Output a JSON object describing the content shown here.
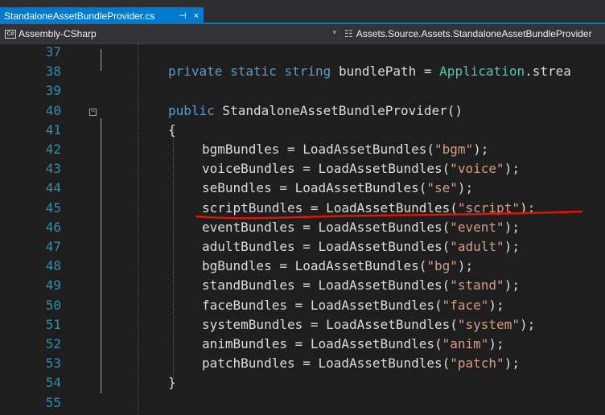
{
  "tab": {
    "filename": "StandaloneAssetBundleProvider.cs",
    "pin_glyph": "⊣",
    "close_glyph": "×"
  },
  "nav": {
    "project": "Assembly-CSharp",
    "project_badge": "C#",
    "scope": "Assets.Source.Assets.StandaloneAssetBundleProvider",
    "dropdown_glyph": "▾"
  },
  "editor": {
    "line_numbers": [
      "37",
      "38",
      "39",
      "40",
      "41",
      "42",
      "43",
      "44",
      "45",
      "46",
      "47",
      "48",
      "49",
      "50",
      "51",
      "52",
      "53",
      "54",
      "55"
    ],
    "lines": [
      {
        "line": "37",
        "indent": 0,
        "tokens": []
      },
      {
        "line": "38",
        "indent": 0,
        "tokens": [
          {
            "t": "kw",
            "v": "private"
          },
          {
            "t": "pl",
            "v": " "
          },
          {
            "t": "kw",
            "v": "static"
          },
          {
            "t": "pl",
            "v": " "
          },
          {
            "t": "kw",
            "v": "string"
          },
          {
            "t": "pl",
            "v": " bundlePath = "
          },
          {
            "t": "type",
            "v": "Application"
          },
          {
            "t": "pl",
            "v": ".strea"
          }
        ]
      },
      {
        "line": "39",
        "indent": 0,
        "tokens": []
      },
      {
        "line": "40",
        "indent": 0,
        "tokens": [
          {
            "t": "kw",
            "v": "public"
          },
          {
            "t": "pl",
            "v": " StandaloneAssetBundleProvider()"
          }
        ]
      },
      {
        "line": "41",
        "indent": 0,
        "tokens": [
          {
            "t": "pl",
            "v": "{"
          }
        ]
      },
      {
        "line": "42",
        "indent": 1,
        "tokens": [
          {
            "t": "pl",
            "v": "bgmBundles = LoadAssetBundles("
          },
          {
            "t": "str",
            "v": "\"bgm\""
          },
          {
            "t": "pl",
            "v": ");"
          }
        ]
      },
      {
        "line": "43",
        "indent": 1,
        "tokens": [
          {
            "t": "pl",
            "v": "voiceBundles = LoadAssetBundles("
          },
          {
            "t": "str",
            "v": "\"voice\""
          },
          {
            "t": "pl",
            "v": ");"
          }
        ]
      },
      {
        "line": "44",
        "indent": 1,
        "tokens": [
          {
            "t": "pl",
            "v": "seBundles = LoadAssetBundles("
          },
          {
            "t": "str",
            "v": "\"se\""
          },
          {
            "t": "pl",
            "v": ");"
          }
        ]
      },
      {
        "line": "45",
        "indent": 1,
        "tokens": [
          {
            "t": "pl",
            "v": "scriptBundles = LoadAssetBundles("
          },
          {
            "t": "str",
            "v": "\"script\""
          },
          {
            "t": "pl",
            "v": ");"
          }
        ]
      },
      {
        "line": "46",
        "indent": 1,
        "tokens": [
          {
            "t": "pl",
            "v": "eventBundles = LoadAssetBundles("
          },
          {
            "t": "str",
            "v": "\"event\""
          },
          {
            "t": "pl",
            "v": ");"
          }
        ]
      },
      {
        "line": "47",
        "indent": 1,
        "tokens": [
          {
            "t": "pl",
            "v": "adultBundles = LoadAssetBundles("
          },
          {
            "t": "str",
            "v": "\"adult\""
          },
          {
            "t": "pl",
            "v": ");"
          }
        ]
      },
      {
        "line": "48",
        "indent": 1,
        "tokens": [
          {
            "t": "pl",
            "v": "bgBundles = LoadAssetBundles("
          },
          {
            "t": "str",
            "v": "\"bg\""
          },
          {
            "t": "pl",
            "v": ");"
          }
        ]
      },
      {
        "line": "49",
        "indent": 1,
        "tokens": [
          {
            "t": "pl",
            "v": "standBundles = LoadAssetBundles("
          },
          {
            "t": "str",
            "v": "\"stand\""
          },
          {
            "t": "pl",
            "v": ");"
          }
        ]
      },
      {
        "line": "50",
        "indent": 1,
        "tokens": [
          {
            "t": "pl",
            "v": "faceBundles = LoadAssetBundles("
          },
          {
            "t": "str",
            "v": "\"face\""
          },
          {
            "t": "pl",
            "v": ");"
          }
        ]
      },
      {
        "line": "51",
        "indent": 1,
        "tokens": [
          {
            "t": "pl",
            "v": "systemBundles = LoadAssetBundles("
          },
          {
            "t": "str",
            "v": "\"system\""
          },
          {
            "t": "pl",
            "v": ");"
          }
        ]
      },
      {
        "line": "52",
        "indent": 1,
        "tokens": [
          {
            "t": "pl",
            "v": "animBundles = LoadAssetBundles("
          },
          {
            "t": "str",
            "v": "\"anim\""
          },
          {
            "t": "pl",
            "v": ");"
          }
        ]
      },
      {
        "line": "53",
        "indent": 1,
        "tokens": [
          {
            "t": "pl",
            "v": "patchBundles = LoadAssetBundles("
          },
          {
            "t": "str",
            "v": "\"patch\""
          },
          {
            "t": "pl",
            "v": ");"
          }
        ]
      },
      {
        "line": "54",
        "indent": 0,
        "tokens": [
          {
            "t": "pl",
            "v": "}"
          }
        ]
      },
      {
        "line": "55",
        "indent": 0,
        "tokens": []
      }
    ]
  },
  "colors": {
    "keyword": "#569cd6",
    "string": "#d69d85",
    "type": "#4ec9b0",
    "plain": "#dcdcdc",
    "line_number": "#2b91af",
    "annotation": "#e51400",
    "accent": "#007acc"
  }
}
